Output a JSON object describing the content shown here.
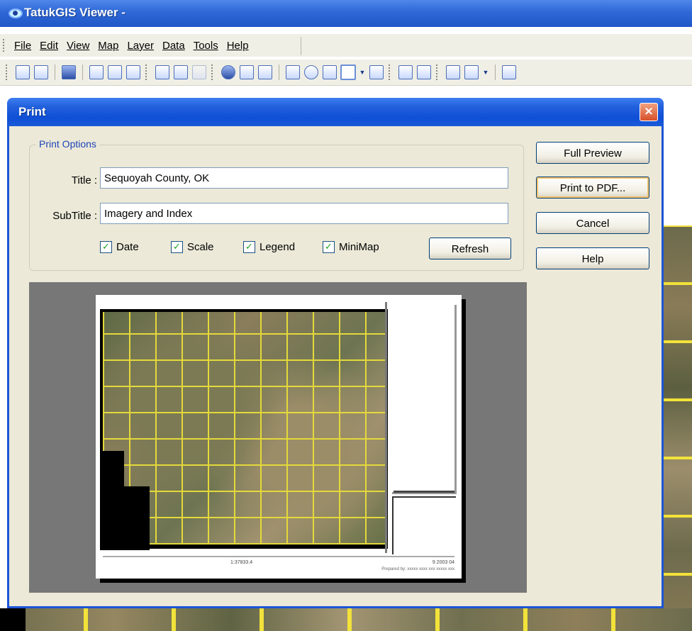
{
  "app": {
    "title": "TatukGIS Viewer -"
  },
  "menu": {
    "items": [
      "File",
      "Edit",
      "View",
      "Map",
      "Layer",
      "Data",
      "Tools",
      "Help"
    ]
  },
  "toolbar": {
    "icons": [
      "new-icon",
      "open-icon",
      "save-icon",
      "print-icon",
      "print-setup-icon",
      "print-preview-icon",
      "copy-icon",
      "paste-icon",
      "delete-icon",
      "globe-icon",
      "zoom-extent-icon",
      "zoom-layer-icon",
      "zoom-window-icon",
      "zoom-icon",
      "pan-icon",
      "select-icon",
      "deselect-icon",
      "add-layer-icon",
      "remove-layer-icon",
      "ruler-icon",
      "edit-icon",
      "search-icon"
    ]
  },
  "dialog": {
    "title": "Print",
    "close_label": "×",
    "group_label": "Print Options",
    "title_label": "Title :",
    "title_value": "Sequoyah County, OK",
    "subtitle_label": "SubTitle :",
    "subtitle_value": "Imagery and Index",
    "checks": [
      {
        "label": "Date",
        "checked": true
      },
      {
        "label": "Scale",
        "checked": true
      },
      {
        "label": "Legend",
        "checked": true
      },
      {
        "label": "MiniMap",
        "checked": true
      }
    ],
    "check_mark": "✓",
    "refresh_label": "Refresh",
    "buttons": {
      "full_preview": "Full Preview",
      "print_pdf": "Print to PDF...",
      "cancel": "Cancel",
      "help": "Help"
    }
  },
  "preview": {
    "scale_text": "1:37833.4",
    "date_text": "9 2003 04",
    "footer_text": "Prepared by: xxxxx xxxx xxx xxxxx xxx"
  }
}
